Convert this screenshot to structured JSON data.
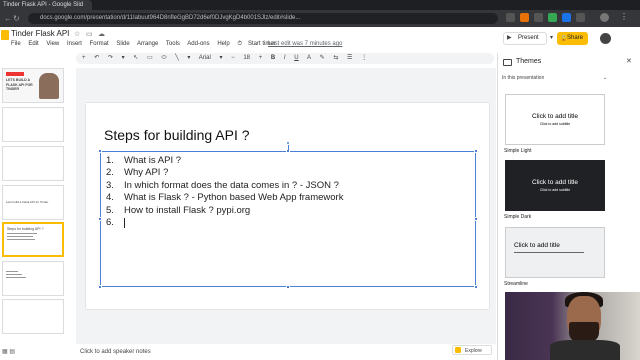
{
  "browser": {
    "tab_title": "Tinder Flask API - Google Slid",
    "url": "docs.google.com/presentation/d/11Iabuut964D8nfleGgBD72d6ef0DJvgKgD4b001SJlz/edit#slide..."
  },
  "doc": {
    "title": "Tinder Flask API",
    "menu": [
      "File",
      "Edit",
      "View",
      "Insert",
      "Format",
      "Slide",
      "Arrange",
      "Tools",
      "Add-ons",
      "Help"
    ],
    "start_timer": "Start timer",
    "last_edit": "Last edit was 7 minutes ago",
    "present_label": "Present",
    "share_label": "Share"
  },
  "toolbar": {
    "font": "Arial",
    "font_size": "18",
    "items": [
      "+",
      "↶",
      "↷",
      "▾",
      "↖",
      "▭",
      "⬭",
      "╲",
      "▾",
      "▾",
      "−",
      "+",
      "B",
      "I",
      "U",
      "A",
      "✎",
      "⇆",
      "☰",
      "⋮"
    ]
  },
  "filmstrip": {
    "slide1_text": "LETS BUILD A FLASK API FOR TINDER",
    "slide5_text": "Steps for building API ?",
    "slide4_text": "Lets build a Flask API for Tinder",
    "bottom_icons": "▦ ▤"
  },
  "slide": {
    "title": "Steps for building API ?",
    "items": [
      {
        "num": "1.",
        "text": "What is API ?"
      },
      {
        "num": "2.",
        "text": "Why API ?"
      },
      {
        "num": "3.",
        "text": "In which format does the data comes in ? - JSON ?"
      },
      {
        "num": "4.",
        "text": "What is Flask ? - Python based Web App framework"
      },
      {
        "num": "5.",
        "text": "How to install Flask ? pypi.org"
      },
      {
        "num": "6.",
        "text": ""
      }
    ]
  },
  "notes": {
    "placeholder": "Click to add speaker notes",
    "explore_label": "Explore"
  },
  "themes_panel": {
    "title": "Themes",
    "section_label": "In this presentation",
    "themes": [
      {
        "name": "",
        "title": "Click to add title",
        "subtitle": "Click to add subtitle"
      },
      {
        "name": "Simple Light",
        "title": "Click to add title",
        "subtitle": "Click to add subtitle"
      },
      {
        "name": "Simple Dark",
        "title": "Click to add title",
        "subtitle": ""
      },
      {
        "name": "Streamline",
        "title": "",
        "subtitle": ""
      }
    ]
  },
  "colors": {
    "accent": "#fbbc04",
    "selection": "#4a80d6",
    "dark_theme_bg": "#202124"
  }
}
